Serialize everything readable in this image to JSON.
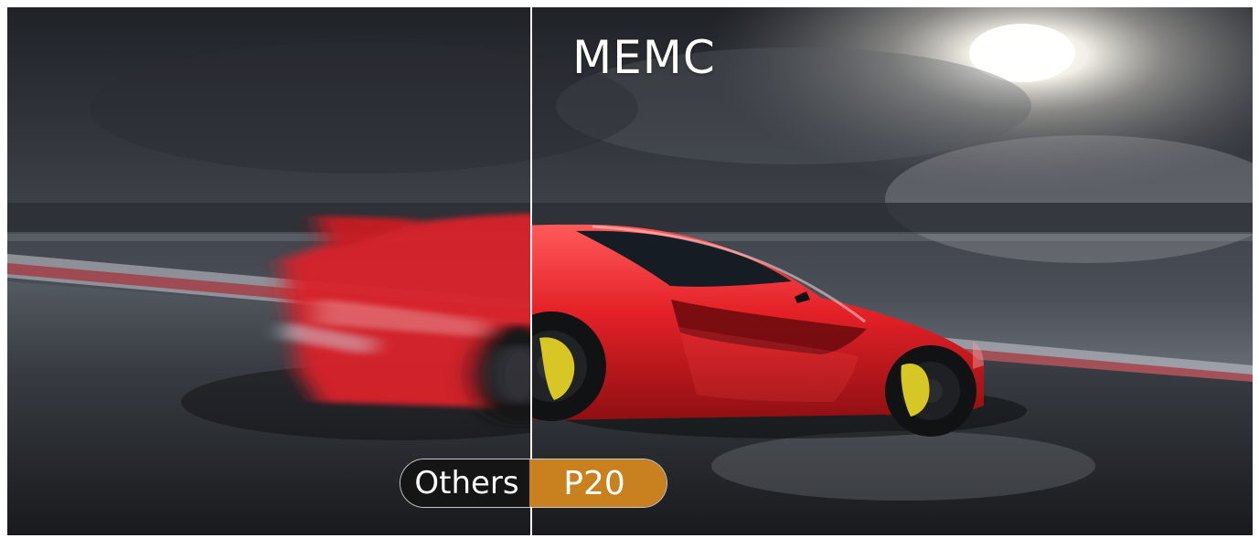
{
  "header": {
    "title": "MEMC"
  },
  "comparison": {
    "left_label": "Others",
    "right_label": "P20"
  },
  "colors": {
    "badge_left": "#151515",
    "badge_right": "#c9801f",
    "car_red": "#d9232b",
    "divider": "#f4f4f4"
  }
}
